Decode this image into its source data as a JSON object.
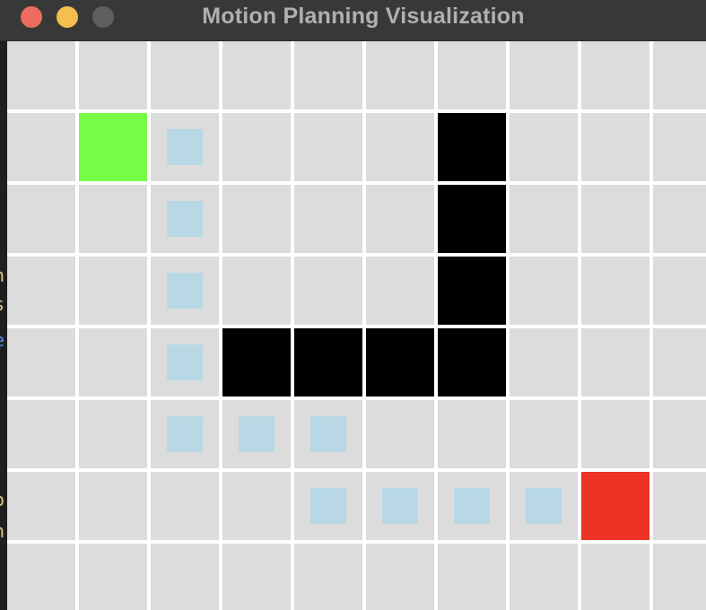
{
  "window": {
    "title": "Motion Planning Visualization",
    "controls": [
      {
        "name": "close-button",
        "icon": "close-icon",
        "color": "#ee6b5f"
      },
      {
        "name": "minimize-button",
        "icon": "minimize-icon",
        "color": "#f5bf4f"
      },
      {
        "name": "zoom-button",
        "icon": "zoom-icon",
        "color": "#5e5e5e"
      }
    ]
  },
  "background_edge_glyphs": [
    "n",
    "s",
    "e",
    "o",
    "n"
  ],
  "colors": {
    "empty": "#dcdcdc",
    "obstacle": "#000000",
    "start": "#76fc47",
    "goal": "#ec3324",
    "path": "#b8d8e6",
    "grid_line": "#ffffff"
  },
  "grid": {
    "columns": 10,
    "rows": 8,
    "legend": {
      "0": "empty",
      "1": "obstacle",
      "S": "start",
      "G": "goal",
      "P": "path"
    },
    "cells": [
      [
        "0",
        "0",
        "0",
        "0",
        "0",
        "0",
        "0",
        "0",
        "0",
        "0"
      ],
      [
        "0",
        "S",
        "P",
        "0",
        "0",
        "0",
        "1",
        "0",
        "0",
        "0"
      ],
      [
        "0",
        "0",
        "P",
        "0",
        "0",
        "0",
        "1",
        "0",
        "0",
        "0"
      ],
      [
        "0",
        "0",
        "P",
        "0",
        "0",
        "0",
        "1",
        "0",
        "0",
        "0"
      ],
      [
        "0",
        "0",
        "P",
        "1",
        "1",
        "1",
        "1",
        "0",
        "0",
        "0"
      ],
      [
        "0",
        "0",
        "P",
        "P",
        "P",
        "0",
        "0",
        "0",
        "0",
        "0"
      ],
      [
        "0",
        "0",
        "0",
        "0",
        "P",
        "P",
        "P",
        "P",
        "G",
        "0"
      ],
      [
        "0",
        "0",
        "0",
        "0",
        "0",
        "0",
        "0",
        "0",
        "0",
        "0"
      ]
    ]
  }
}
